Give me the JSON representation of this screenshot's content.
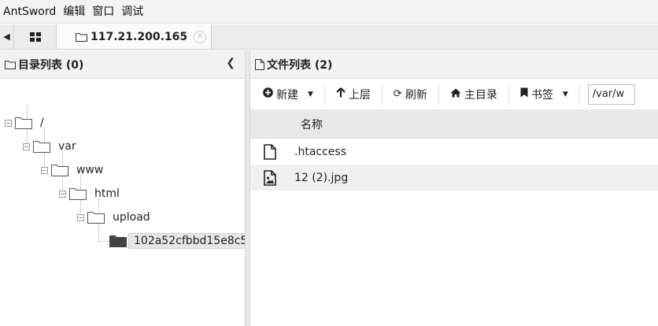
{
  "menubar": {
    "items": [
      "AntSword",
      "编辑",
      "窗口",
      "调试"
    ]
  },
  "tabbar": {
    "active_tab": "117.21.200.165"
  },
  "left_panel": {
    "title": "目录列表 (0)",
    "tree": [
      {
        "label": "/",
        "level": 0,
        "expanded": true
      },
      {
        "label": "var",
        "level": 1,
        "expanded": true
      },
      {
        "label": "www",
        "level": 2,
        "expanded": true
      },
      {
        "label": "html",
        "level": 3,
        "expanded": true
      },
      {
        "label": "upload",
        "level": 4,
        "expanded": true
      },
      {
        "label": "102a52cfbbd15e8c5",
        "level": 5,
        "selected": true
      }
    ]
  },
  "right_panel": {
    "title": "文件列表 (2)",
    "toolbar": {
      "new_label": "新建",
      "up_label": "上层",
      "refresh_label": "刷新",
      "home_label": "主目录",
      "bookmark_label": "书签",
      "path_value": "/var/w"
    },
    "columns": [
      "名称"
    ],
    "files": [
      {
        "name": ".htaccess",
        "icon": "file-icon"
      },
      {
        "name": "12 (2).jpg",
        "icon": "image-file-icon"
      }
    ]
  }
}
